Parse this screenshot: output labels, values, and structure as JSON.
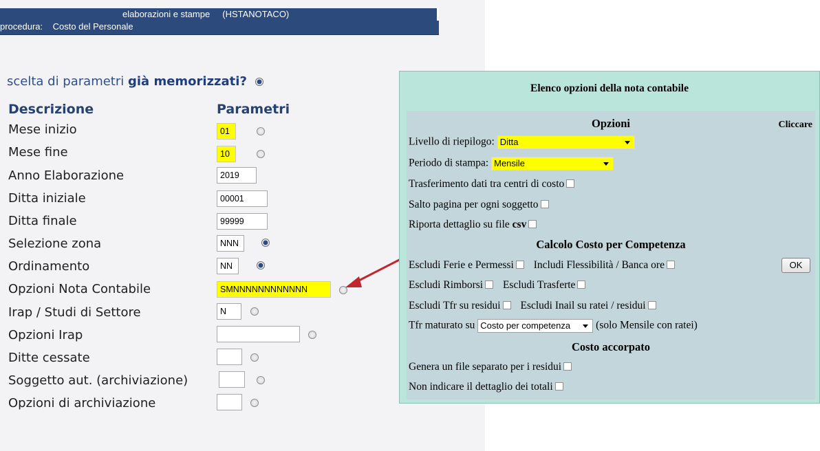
{
  "header": {
    "line1": "elaborazioni e stampe     (HSTANOTACO)",
    "line2": "procedura:    Costo del Personale"
  },
  "question": {
    "text": "scelta di parametri ",
    "bold": "già memorizzati?"
  },
  "columns": {
    "description": "Descrizione",
    "parameters": "Parametri"
  },
  "params": [
    {
      "label": "Mese inizio",
      "value": "01"
    },
    {
      "label": "Mese fine",
      "value": "10"
    },
    {
      "label": "Anno Elaborazione",
      "value": "2019"
    },
    {
      "label": "Ditta iniziale",
      "value": "00001"
    },
    {
      "label": "Ditta finale",
      "value": "99999"
    },
    {
      "label": "Selezione zona",
      "value": "NNN"
    },
    {
      "label": "Ordinamento",
      "value": "NN"
    },
    {
      "label": "Opzioni Nota Contabile",
      "value": "SMNNNNNNNNNNNN"
    },
    {
      "label": "Irap / Studi di Settore",
      "value": "N"
    },
    {
      "label": "Opzioni Irap",
      "value": ""
    },
    {
      "label": "Ditte cessate",
      "value": ""
    },
    {
      "label": "Soggetto aut. (archiviazione)",
      "value": ""
    },
    {
      "label": "Opzioni di archiviazione",
      "value": ""
    }
  ],
  "popup": {
    "title": "Elenco opzioni della nota contabile",
    "section_opzioni": "Opzioni",
    "cliccare": "Cliccare",
    "livello_label": "Livello di riepilogo:",
    "livello_value": "Ditta",
    "periodo_label": "Periodo di stampa:",
    "periodo_value": "Mensile",
    "trasferimento": "Trasferimento dati tra centri di costo",
    "salto": "Salto pagina per ogni soggetto",
    "riporta": "Riporta dettaglio su file ",
    "riporta_bold": "csv",
    "section_competenza": "Calcolo Costo per Competenza",
    "escludi_ferie": "Escludi Ferie e Permessi",
    "includi_flessibilita": "Includi Flessibilità / Banca ore",
    "ok": "OK",
    "escludi_rimborsi": "Escludi Rimborsi",
    "escludi_trasferte": "Escludi Trasferte",
    "escludi_tfr": "Escludi Tfr su residui",
    "escludi_inail": "Escludi Inail su ratei / residui",
    "tfr_label": "Tfr maturato su",
    "tfr_value": "Costo per competenza",
    "tfr_note": "(solo Mensile con ratei)",
    "section_accorpato": "Costo accorpato",
    "genera": "Genera un file separato per i residui",
    "non_indicare": "Non indicare il dettaglio dei totali"
  },
  "colors": {
    "header_bg": "#2d4a7c",
    "highlight": "#ffff00",
    "popup_bg": "#b9e5db",
    "popup_inner_bg": "#c3d6dc",
    "arrow": "#c0262b"
  }
}
